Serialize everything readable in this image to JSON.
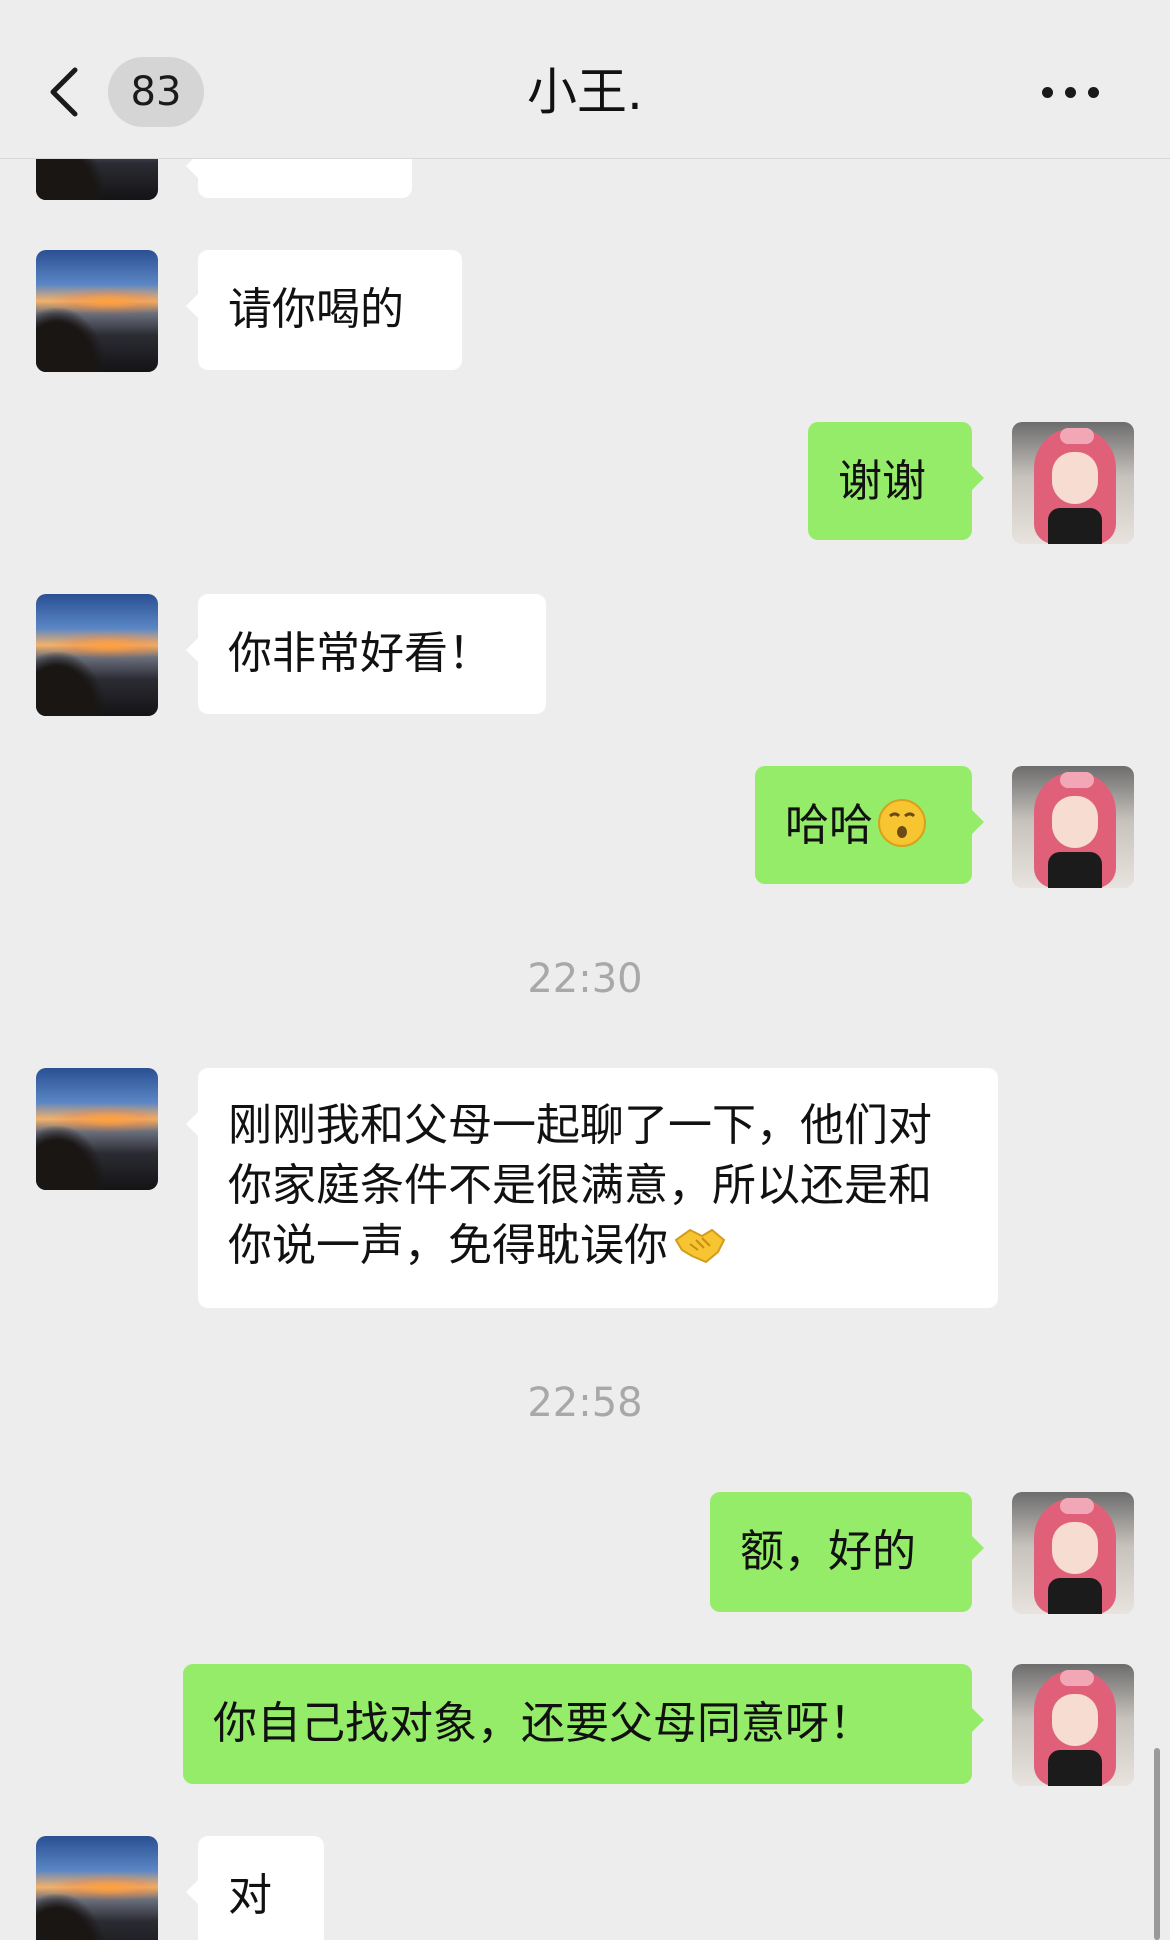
{
  "header": {
    "unread_count": "83",
    "title": "小王."
  },
  "messages": {
    "m0_partial": "",
    "m1": "请你喝的",
    "m2": "谢谢",
    "m3": "你非常好看！",
    "m4": "哈哈",
    "t1": "22:30",
    "m5": "刚刚我和父母一起聊了一下，他们对你家庭条件不是很满意，所以还是和你说一声，免得耽误你",
    "t2": "22:58",
    "m6": "额，好的",
    "m7": "你自己找对象，还要父母同意呀！",
    "m8": "对"
  },
  "icons": {
    "back": "chevron-left-icon",
    "more": "more-dots-icon",
    "emoji_m4": "emoji-smirk-icon",
    "emoji_m5": "handshake-icon"
  },
  "colors": {
    "background": "#ededed",
    "incoming_bubble": "#ffffff",
    "outgoing_bubble": "#95ec69",
    "timestamp": "#a8a8a8"
  }
}
